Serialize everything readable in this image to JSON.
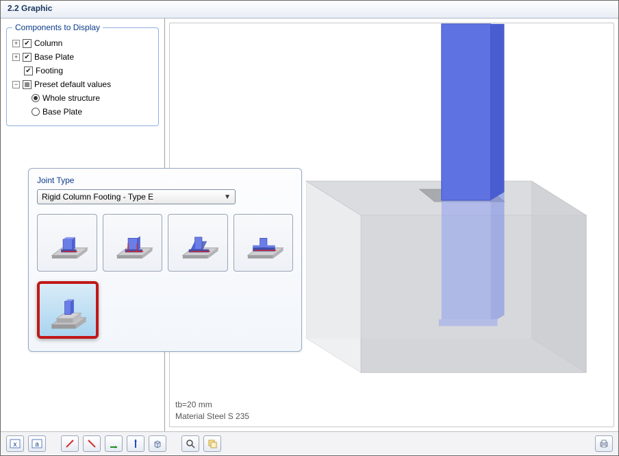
{
  "title": "2.2 Graphic",
  "components_legend": "Components to Display",
  "tree": {
    "column": "Column",
    "base_plate": "Base Plate",
    "footing": "Footing",
    "preset": "Preset default values",
    "whole_structure": "Whole structure",
    "bp_radio": "Base Plate"
  },
  "joint": {
    "title": "Joint Type",
    "selected": "Rigid Column Footing - Type E",
    "option_names": [
      "type-a",
      "type-b",
      "type-c",
      "type-d",
      "type-e"
    ]
  },
  "status": {
    "line1": "tb=20 mm",
    "line2": "Material Steel S 235"
  },
  "toolbar": {
    "btn_x": "x",
    "btn_a": "a"
  },
  "colors": {
    "accent_blue": "#4f63d6",
    "steel_blue": "#6b7ee8",
    "concrete": "#cfcfd1",
    "concrete_edge": "#9c9c9e",
    "selected_red": "#c01818"
  }
}
